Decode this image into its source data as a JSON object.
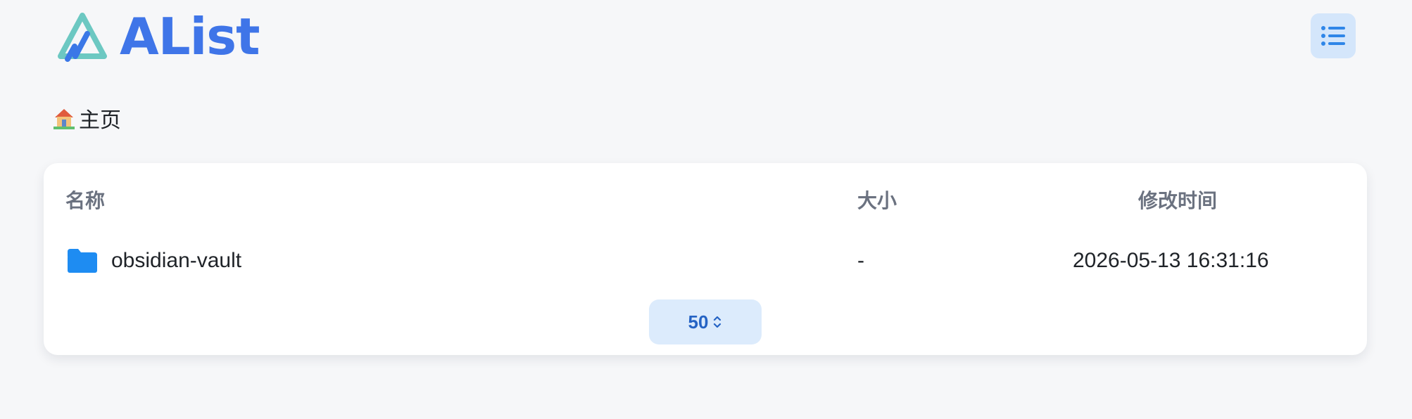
{
  "header": {
    "logo_text": "AList",
    "menu_icon": "list-icon"
  },
  "breadcrumb": {
    "home_icon": "house-emoji",
    "label": "主页"
  },
  "table": {
    "columns": [
      "名称",
      "大小",
      "修改时间"
    ],
    "rows": [
      {
        "icon": "folder-icon",
        "name": "obsidian-vault",
        "size": "-",
        "modified": "2026-05-13 16:31:16"
      }
    ]
  },
  "pagination": {
    "page_size": "50",
    "icon": "chevron-up-down-icon"
  },
  "colors": {
    "brand": "#3f75e8",
    "folder": "#1e8cf2",
    "background": "#f6f7f9",
    "menu_button_bg": "#d4e6fb"
  }
}
